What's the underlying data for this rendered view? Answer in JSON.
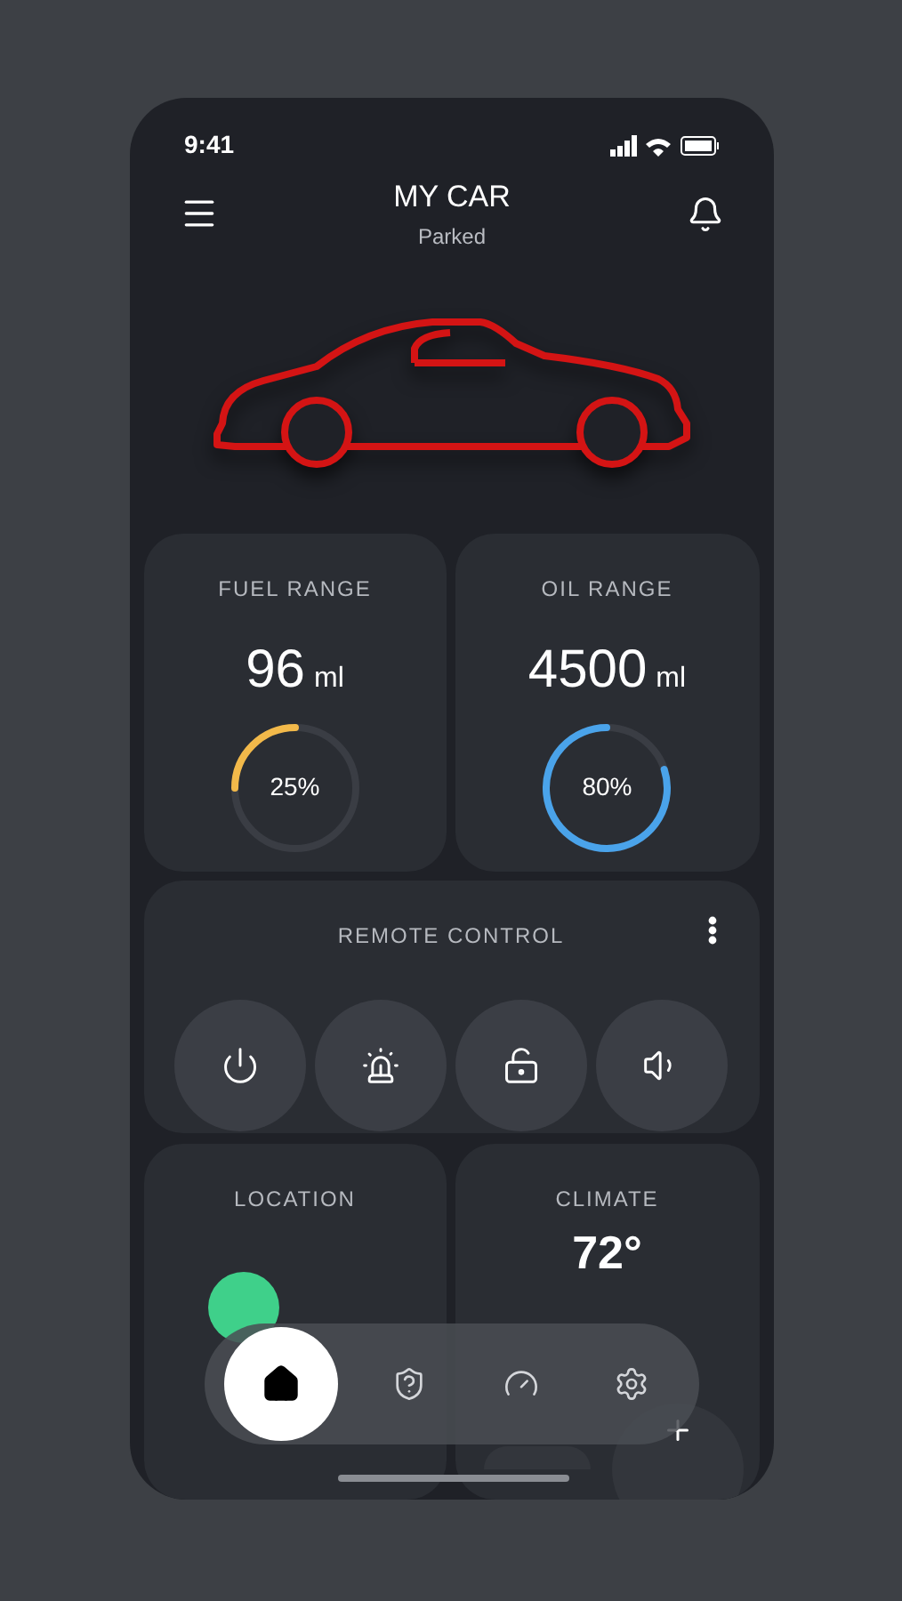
{
  "status_bar": {
    "time": "9:41"
  },
  "header": {
    "title": "MY CAR",
    "subtitle": "Parked"
  },
  "gauges": [
    {
      "label": "FUEL RANGE",
      "value": "96",
      "unit": "ml",
      "reading": "25%",
      "color": "#f2b94a"
    },
    {
      "label": "OIL RANGE",
      "value": "4500",
      "unit": "ml",
      "reading": "80%",
      "color": "#4aa3ea"
    }
  ],
  "remote_control": {
    "title": "REMOTE CONTROL",
    "buttons": [
      {
        "kind": "power"
      },
      {
        "kind": "alarm"
      },
      {
        "kind": "lock"
      },
      {
        "kind": "sound"
      }
    ]
  },
  "location": {
    "title": "LOCATION"
  },
  "climate": {
    "title": "CLIMATE",
    "value": "72°"
  },
  "nav": [
    {
      "kind": "home",
      "selected": true
    },
    {
      "kind": "security",
      "selected": false
    },
    {
      "kind": "speed",
      "selected": false
    },
    {
      "kind": "settings",
      "selected": false
    }
  ]
}
